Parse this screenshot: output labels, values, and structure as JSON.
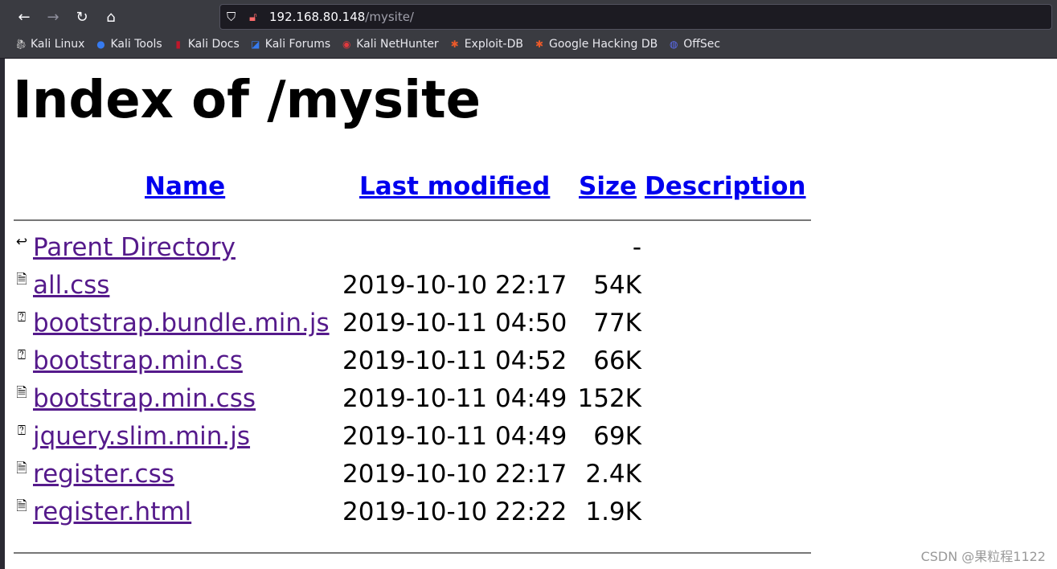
{
  "browser": {
    "url_host": "192.168.80.148",
    "url_path": "/mysite/",
    "bookmarks": [
      {
        "label": "Kali Linux",
        "icon": "kali-dragon-icon",
        "color": "#cccccc"
      },
      {
        "label": "Kali Tools",
        "icon": "kali-tools-icon",
        "color": "#367bf0"
      },
      {
        "label": "Kali Docs",
        "icon": "kali-docs-icon",
        "color": "#c0172a"
      },
      {
        "label": "Kali Forums",
        "icon": "kali-forums-icon",
        "color": "#367bf0"
      },
      {
        "label": "Kali NetHunter",
        "icon": "nethunter-icon",
        "color": "#e0393e"
      },
      {
        "label": "Exploit-DB",
        "icon": "exploit-db-icon",
        "color": "#ec5a29"
      },
      {
        "label": "Google Hacking DB",
        "icon": "ghdb-icon",
        "color": "#ec5a29"
      },
      {
        "label": "OffSec",
        "icon": "offsec-icon",
        "color": "#5b6cf0"
      }
    ]
  },
  "page": {
    "title": "Index of /mysite",
    "headers": {
      "name": "Name",
      "modified": "Last modified",
      "size": "Size",
      "description": "Description"
    },
    "rows": [
      {
        "icon": "back-icon",
        "name": "Parent Directory",
        "date": "",
        "size": "-"
      },
      {
        "icon": "text-file-icon",
        "name": "all.css",
        "date": "2019-10-10 22:17",
        "size": "54K"
      },
      {
        "icon": "unknown-file-icon",
        "name": "bootstrap.bundle.min.js",
        "date": "2019-10-11 04:50",
        "size": "77K"
      },
      {
        "icon": "unknown-file-icon",
        "name": "bootstrap.min.cs",
        "date": "2019-10-11 04:52",
        "size": "66K"
      },
      {
        "icon": "text-file-icon",
        "name": "bootstrap.min.css",
        "date": "2019-10-11 04:49",
        "size": "152K"
      },
      {
        "icon": "unknown-file-icon",
        "name": "jquery.slim.min.js",
        "date": "2019-10-11 04:49",
        "size": "69K"
      },
      {
        "icon": "text-file-icon",
        "name": "register.css",
        "date": "2019-10-10 22:17",
        "size": "2.4K"
      },
      {
        "icon": "text-file-icon",
        "name": "register.html",
        "date": "2019-10-10 22:22",
        "size": "1.9K"
      }
    ]
  },
  "watermark": "CSDN @果粒程1122"
}
